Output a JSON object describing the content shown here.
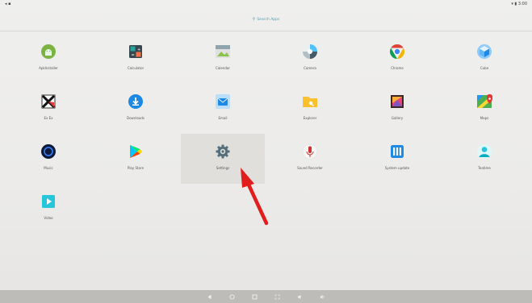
{
  "status": {
    "left": "◂ ▪",
    "right": "▾ ▮ 3:00"
  },
  "search": {
    "placeholder": "Search Apps"
  },
  "apps": [
    {
      "id": "apkinstaller",
      "label": "ApkInstaller",
      "icon": "android-icon"
    },
    {
      "id": "calculator",
      "label": "Calculator",
      "icon": "calculator-icon"
    },
    {
      "id": "calendar",
      "label": "Calendar",
      "icon": "calendar-icon"
    },
    {
      "id": "camera",
      "label": "Camera",
      "icon": "camera-icon"
    },
    {
      "id": "chrome",
      "label": "Chrome",
      "icon": "chrome-icon"
    },
    {
      "id": "cube",
      "label": "Cube",
      "icon": "cube-icon"
    },
    {
      "id": "exkeys",
      "label": "Ex Ex",
      "icon": "x-icon"
    },
    {
      "id": "downloads",
      "label": "Downloads",
      "icon": "download-icon"
    },
    {
      "id": "email",
      "label": "Email",
      "icon": "email-icon"
    },
    {
      "id": "explorer",
      "label": "Explorer",
      "icon": "folder-icon"
    },
    {
      "id": "gallery",
      "label": "Gallery",
      "icon": "gallery-icon"
    },
    {
      "id": "maps",
      "label": "Maps",
      "icon": "maps-icon"
    },
    {
      "id": "music",
      "label": "Music",
      "icon": "music-icon"
    },
    {
      "id": "playstore",
      "label": "Play Store",
      "icon": "play-store-icon"
    },
    {
      "id": "settings",
      "label": "Settings",
      "icon": "gear-icon",
      "selected": true
    },
    {
      "id": "soundrecorder",
      "label": "Sound Recorder",
      "icon": "microphone-icon"
    },
    {
      "id": "systemupdate",
      "label": "System update",
      "icon": "columns-icon"
    },
    {
      "id": "teatime",
      "label": "Teatime",
      "icon": "person-icon"
    },
    {
      "id": "video",
      "label": "Video",
      "icon": "video-icon"
    }
  ],
  "colors": {
    "accent": "#4aa3b8",
    "arrow": "#e11d1d"
  }
}
